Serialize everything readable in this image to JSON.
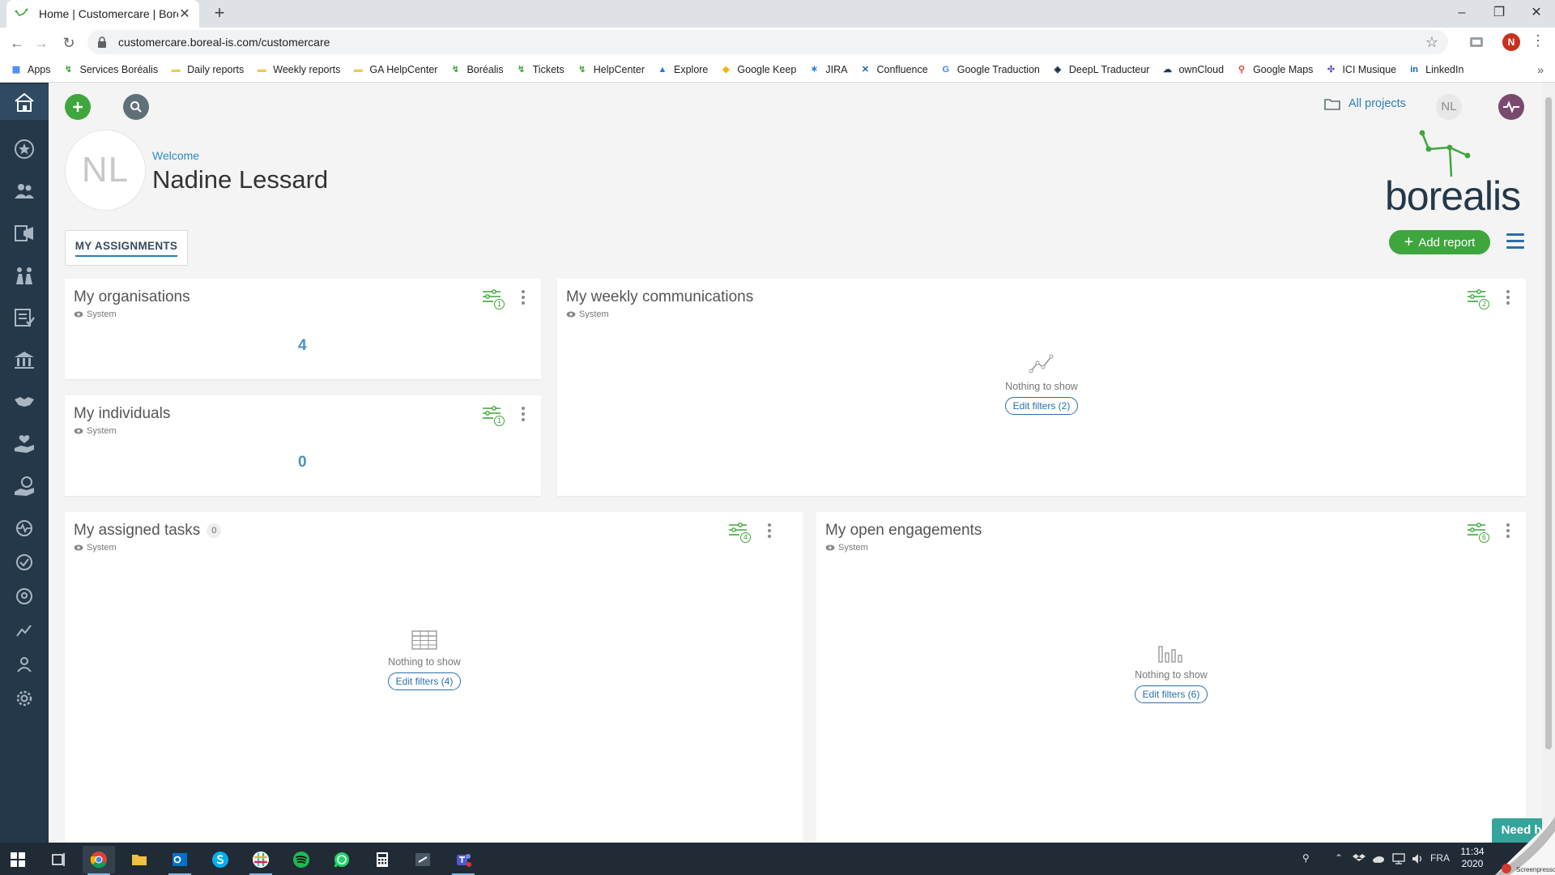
{
  "browser": {
    "tab_title": "Home | Customercare | Boréalis",
    "new_tab_symbol": "+",
    "url": "customercare.boreal-is.com/customercare",
    "profile_initial": "N",
    "bookmarks": [
      {
        "label": "Apps",
        "icon": "apps-grid-icon"
      },
      {
        "label": "Services Boréalis",
        "icon": "borealis-icon"
      },
      {
        "label": "Daily reports",
        "icon": "folder-icon"
      },
      {
        "label": "Weekly reports",
        "icon": "folder-icon"
      },
      {
        "label": "GA HelpCenter",
        "icon": "folder-icon"
      },
      {
        "label": "Boréalis",
        "icon": "borealis-icon"
      },
      {
        "label": "Tickets",
        "icon": "borealis-icon"
      },
      {
        "label": "HelpCenter",
        "icon": "borealis-icon"
      },
      {
        "label": "Explore",
        "icon": "explore-icon"
      },
      {
        "label": "Google Keep",
        "icon": "keep-icon"
      },
      {
        "label": "JIRA",
        "icon": "jira-icon"
      },
      {
        "label": "Confluence",
        "icon": "confluence-icon"
      },
      {
        "label": "Google Traduction",
        "icon": "translate-icon"
      },
      {
        "label": "DeepL Traducteur",
        "icon": "deepl-icon"
      },
      {
        "label": "ownCloud",
        "icon": "cloud-icon"
      },
      {
        "label": "Google Maps",
        "icon": "maps-pin-icon"
      },
      {
        "label": "ICI Musique",
        "icon": "music-icon"
      },
      {
        "label": "LinkedIn",
        "icon": "linkedin-icon"
      }
    ],
    "bookmarks_more": "»"
  },
  "header": {
    "all_projects": "All projects",
    "user_initials": "NL"
  },
  "profile": {
    "avatar_initials": "NL",
    "welcome": "Welcome",
    "name": "Nadine Lessard"
  },
  "logo": {
    "word": "borealis"
  },
  "tabs": [
    {
      "label": "MY ASSIGNMENTS",
      "active": true
    }
  ],
  "add_report": {
    "plus": "+",
    "label": "Add report"
  },
  "cards": {
    "organisations": {
      "title": "My organisations",
      "visibility": "System",
      "filter_count": "1",
      "value": "4"
    },
    "individuals": {
      "title": "My individuals",
      "visibility": "System",
      "filter_count": "1",
      "value": "0"
    },
    "weekly": {
      "title": "My weekly communications",
      "visibility": "System",
      "filter_count": "2",
      "empty_message": "Nothing to show",
      "edit_label": "Edit filters (2)"
    },
    "tasks": {
      "title": "My assigned tasks",
      "count": "0",
      "visibility": "System",
      "filter_count": "4",
      "empty_message": "Nothing to show",
      "edit_label": "Edit filters (4)"
    },
    "engagements": {
      "title": "My open engagements",
      "visibility": "System",
      "filter_count": "6",
      "empty_message": "Nothing to show",
      "edit_label": "Edit filters (6)"
    }
  },
  "need_help": "Need help?",
  "taskbar": {
    "language": "FRA",
    "time": "11:34",
    "date": "2020",
    "screenpresso": "Screenpresso"
  },
  "colors": {
    "sidebar": "#24384a",
    "accent_green": "#3ea63c",
    "link_blue": "#2b7fb5",
    "help_teal": "#35a49a"
  }
}
